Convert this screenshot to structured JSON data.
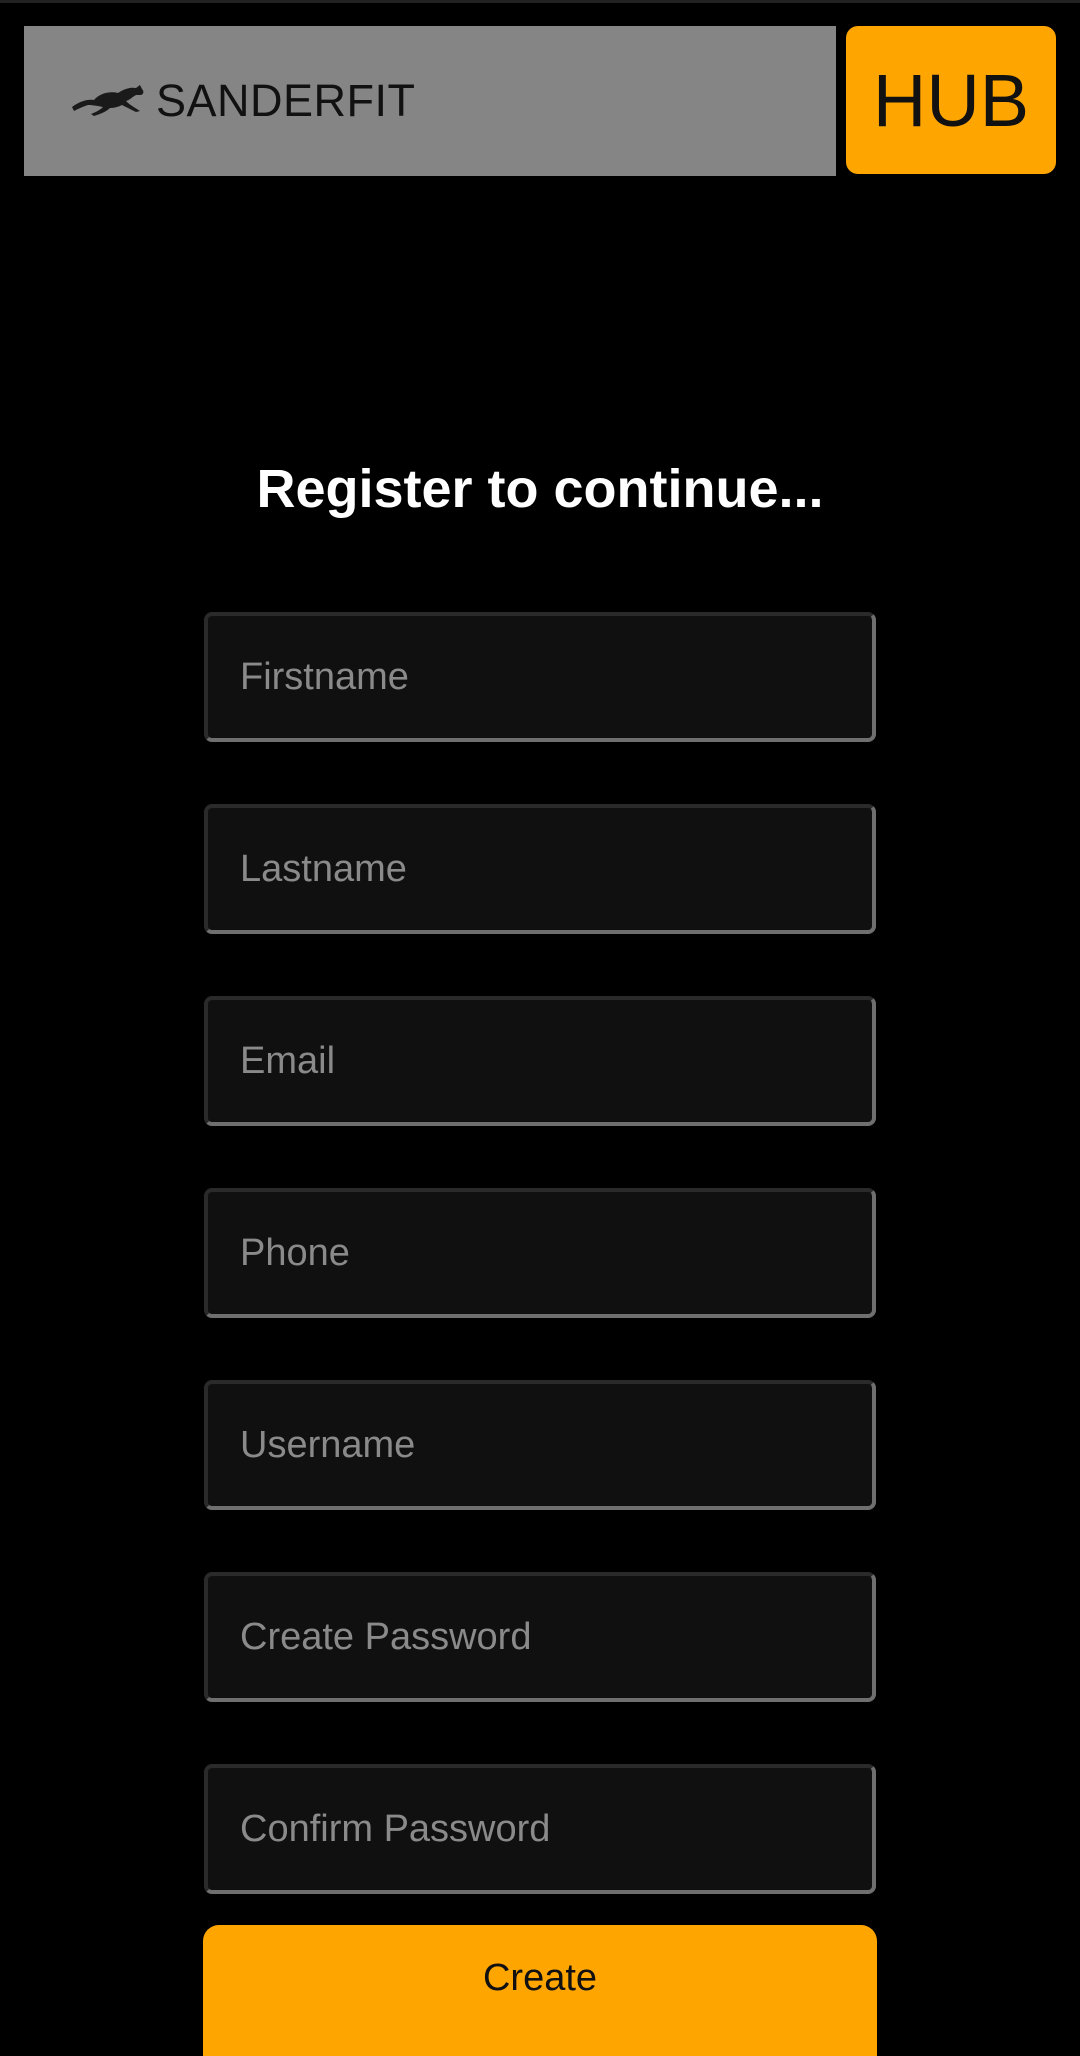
{
  "header": {
    "brand_name": "SANDERFIT",
    "logo_icon": "horse-icon",
    "hub_label": "HUB"
  },
  "form": {
    "heading": "Register to continue...",
    "fields": [
      {
        "name": "firstname",
        "placeholder": "Firstname",
        "value": ""
      },
      {
        "name": "lastname",
        "placeholder": "Lastname",
        "value": ""
      },
      {
        "name": "email",
        "placeholder": "Email",
        "value": ""
      },
      {
        "name": "phone",
        "placeholder": "Phone",
        "value": ""
      },
      {
        "name": "username",
        "placeholder": "Username",
        "value": ""
      },
      {
        "name": "create-password",
        "placeholder": "Create Password",
        "value": ""
      },
      {
        "name": "confirm-password",
        "placeholder": "Confirm Password",
        "value": ""
      }
    ],
    "submit_label": "Create"
  },
  "colors": {
    "background": "#000000",
    "accent": "#ffa500",
    "brand_bar": "#858585",
    "field_background": "#101010",
    "placeholder": "#8a8a8a"
  }
}
